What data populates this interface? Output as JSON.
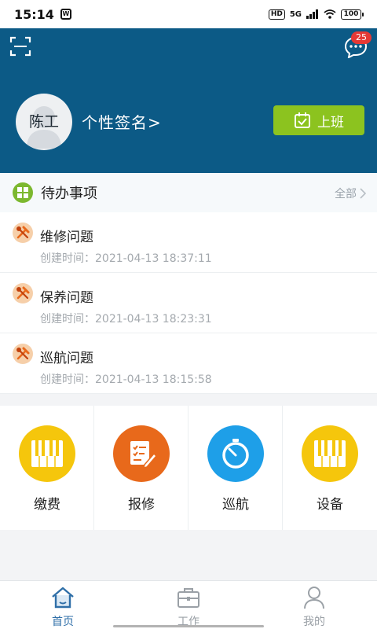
{
  "status_bar": {
    "time": "15:14",
    "network": "5G",
    "hd": "HD",
    "battery": "100"
  },
  "header": {
    "message_badge": "25",
    "avatar_name": "陈工",
    "signature": "个性签名>",
    "checkin_label": "上班"
  },
  "todo": {
    "title": "待办事项",
    "all_label": "全部",
    "items": [
      {
        "title": "维修问题",
        "time": "创建时间：2021-04-13 18:37:11"
      },
      {
        "title": "保养问题",
        "time": "创建时间：2021-04-13 18:23:31"
      },
      {
        "title": "巡航问题",
        "time": "创建时间：2021-04-13 18:15:58"
      }
    ]
  },
  "grid": [
    {
      "label": "缴费",
      "icon": "piano-icon",
      "color": "#f5c60c"
    },
    {
      "label": "报修",
      "icon": "checklist-pen-icon",
      "color": "#e8691b"
    },
    {
      "label": "巡航",
      "icon": "stopwatch-icon",
      "color": "#1e9fe8"
    },
    {
      "label": "设备",
      "icon": "piano-icon",
      "color": "#f5c60c"
    }
  ],
  "tabs": [
    {
      "label": "首页",
      "icon": "home-icon"
    },
    {
      "label": "工作",
      "icon": "briefcase-icon"
    },
    {
      "label": "我的",
      "icon": "user-icon"
    }
  ],
  "colors": {
    "header": "#0c5a86",
    "accent_green": "#8cc31f",
    "active_tab": "#2f6fa8"
  }
}
